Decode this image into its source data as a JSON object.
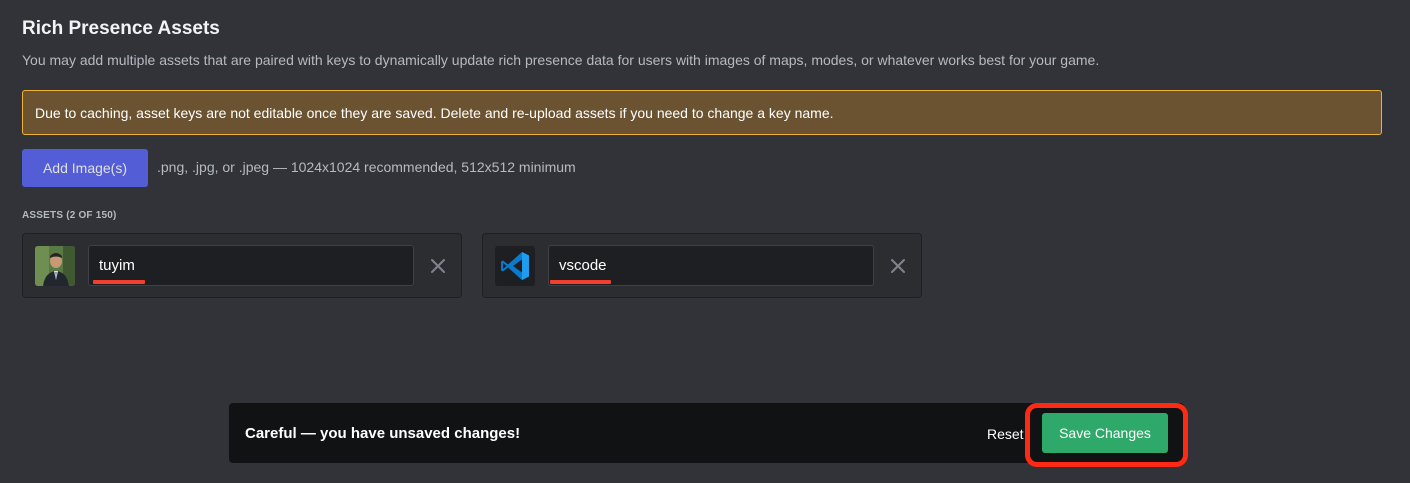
{
  "header": {
    "title": "Rich Presence Assets",
    "description": "You may add multiple assets that are paired with keys to dynamically update rich presence data for users with images of maps, modes, or whatever works best for your game."
  },
  "warning": {
    "text": "Due to caching, asset keys are not editable once they are saved. Delete and re-upload assets if you need to change a key name."
  },
  "upload": {
    "button_label": "Add Image(s)",
    "hint": ".png, .jpg, or .jpeg — 1024x1024 recommended, 512x512 minimum"
  },
  "assets": {
    "label": "ASSETS (2 OF 150)",
    "items": [
      {
        "key": "tuyim",
        "thumbnail": "profile-photo"
      },
      {
        "key": "vscode",
        "thumbnail": "vscode-logo-icon"
      }
    ]
  },
  "unsaved_bar": {
    "message": "Careful — you have unsaved changes!",
    "reset_label": "Reset",
    "save_label": "Save Changes"
  },
  "colors": {
    "background": "#313338",
    "warning_bg": "#6b5331",
    "warning_border": "#f0b232",
    "primary": "#5865f2",
    "save": "#2ea969",
    "highlight": "#ff2a14"
  }
}
